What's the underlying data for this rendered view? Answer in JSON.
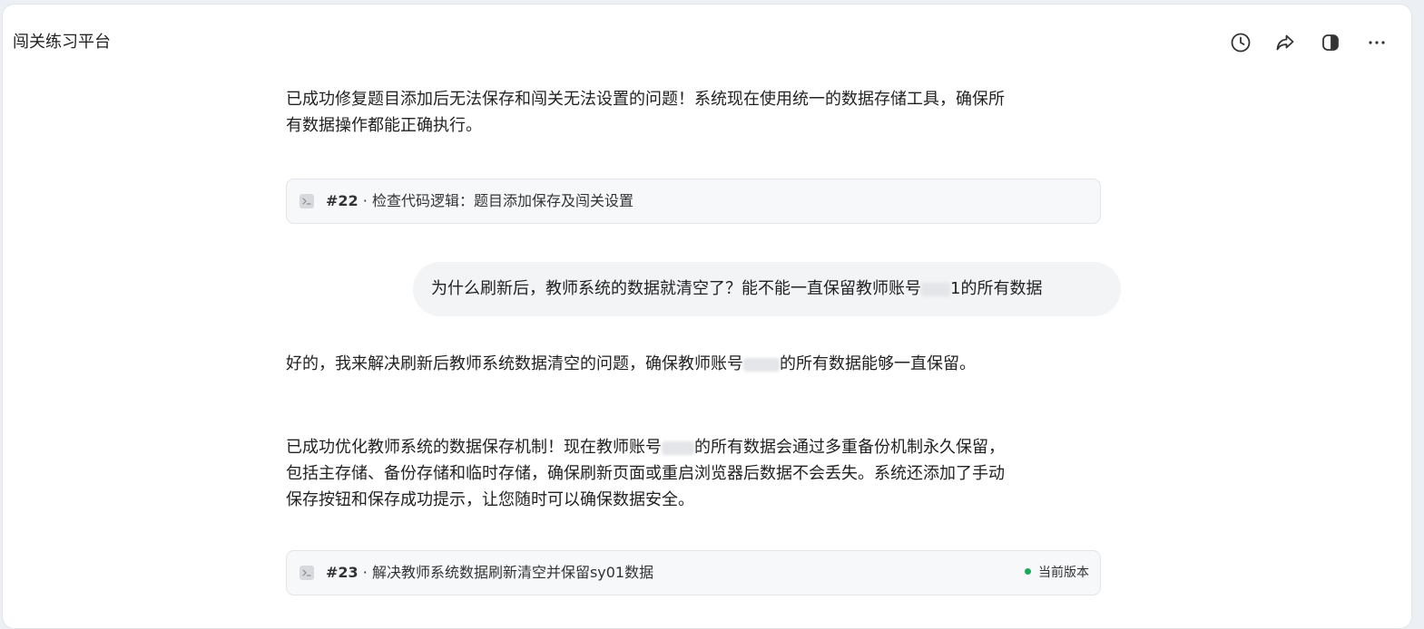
{
  "app": {
    "title": "闯关练习平台"
  },
  "toolbar": {
    "history_icon": "clock-icon",
    "share_icon": "share-arrow-icon",
    "layout_icon": "split-panel-icon",
    "more_icon": "more-horizontal-icon"
  },
  "messages": {
    "assistant_1": "已成功修复题目添加后无法保存和闯关无法设置的问题！系统现在使用统一的数据存储工具，确保所有数据操作都能正确执行。",
    "card_1": {
      "number": "#22",
      "separator": " · ",
      "title": "检查代码逻辑：题目添加保存及闯关设置",
      "icon": "terminal-icon"
    },
    "user_1": {
      "before_mask": "为什么刷新后，教师系统的数据就清空了？能不能一直保留教师账号",
      "after_mask": "1的所有数据"
    },
    "assistant_2": {
      "before_mask": "好的，我来解决刷新后教师系统数据清空的问题，确保教师账号",
      "after_mask": "的所有数据能够一直保留。"
    },
    "assistant_3": {
      "before_mask": "已成功优化教师系统的数据保存机制！现在教师账号",
      "after_mask": "的所有数据会通过多重备份机制永久保留，包括主存储、备份存储和临时存储，确保刷新页面或重启浏览器后数据不会丢失。系统还添加了手动保存按钮和保存成功提示，让您随时可以确保数据安全。"
    },
    "card_2": {
      "number": "#23",
      "separator": " · ",
      "title": "解决教师系统数据刷新清空并保留sy01数据",
      "status": "当前版本",
      "status_color": "#1aaa55",
      "icon": "terminal-icon"
    }
  }
}
